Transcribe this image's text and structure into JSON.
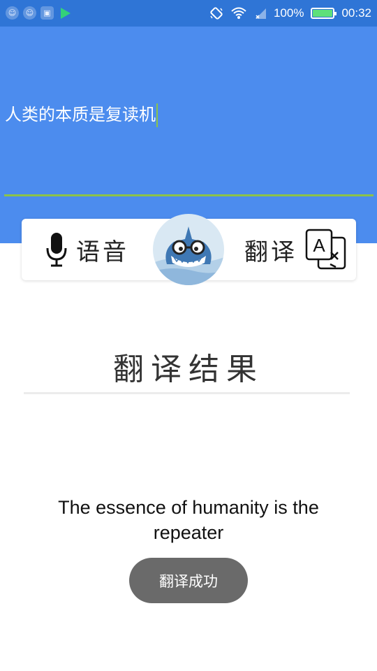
{
  "status_bar": {
    "left_icons": [
      "android-robot-icon",
      "android-robot-icon",
      "gallery-icon",
      "play-store-icon"
    ],
    "battery_percent": "100%",
    "battery_level": 1.0,
    "time": "00:32",
    "right_icons": [
      "rotate-icon",
      "wifi-icon",
      "signal-icon",
      "battery-icon"
    ]
  },
  "input": {
    "text": "人类的本质是复读机",
    "underline_color": "#8bc34a"
  },
  "actions": {
    "voice_label": "语音",
    "translate_label": "翻译",
    "mascot_icon": "shark-mascot-icon"
  },
  "result": {
    "title": "翻译结果",
    "text": "The essence of humanity is the repeater"
  },
  "toast": {
    "message": "翻译成功"
  },
  "colors": {
    "status_bar": "#2f75d6",
    "header": "#4c8cee",
    "accent": "#8bc34a"
  }
}
